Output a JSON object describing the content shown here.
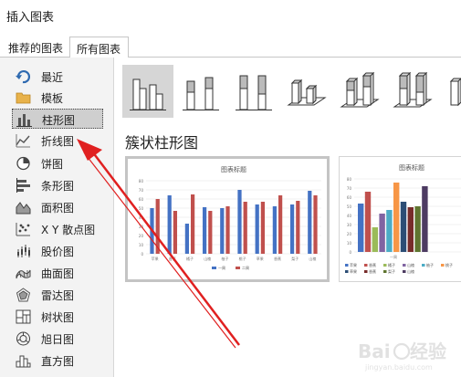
{
  "window": {
    "title": "插入图表"
  },
  "tabs": [
    {
      "label": "推荐的图表"
    },
    {
      "label": "所有图表",
      "selected": true
    }
  ],
  "sidebar": {
    "items": [
      {
        "label": "最近",
        "icon": "recent-icon"
      },
      {
        "label": "模板",
        "icon": "folder-icon"
      },
      {
        "label": "柱形图",
        "icon": "column-chart-icon",
        "selected": true
      },
      {
        "label": "折线图",
        "icon": "line-chart-icon"
      },
      {
        "label": "饼图",
        "icon": "pie-chart-icon"
      },
      {
        "label": "条形图",
        "icon": "bar-chart-icon"
      },
      {
        "label": "面积图",
        "icon": "area-chart-icon"
      },
      {
        "label": "X Y 散点图",
        "icon": "scatter-chart-icon"
      },
      {
        "label": "股价图",
        "icon": "stock-chart-icon"
      },
      {
        "label": "曲面图",
        "icon": "surface-chart-icon"
      },
      {
        "label": "雷达图",
        "icon": "radar-chart-icon"
      },
      {
        "label": "树状图",
        "icon": "treemap-icon"
      },
      {
        "label": "旭日图",
        "icon": "sunburst-icon"
      },
      {
        "label": "直方图",
        "icon": "histogram-icon"
      }
    ]
  },
  "subtypes": [
    {
      "icon": "clustered-column-icon",
      "selected": true
    },
    {
      "icon": "stacked-column-icon"
    },
    {
      "icon": "percent-stacked-column-icon"
    },
    {
      "icon": "3d-clustered-column-icon"
    },
    {
      "icon": "3d-stacked-column-icon"
    },
    {
      "icon": "3d-percent-stacked-column-icon"
    },
    {
      "icon": "3d-column-icon"
    }
  ],
  "main": {
    "subtype_title": "簇状柱形图"
  },
  "colors": {
    "series1": "#4472c4",
    "series2": "#c0504d",
    "arrow": "#e02020",
    "selected_bg": "#d6d6d6"
  },
  "chart_data": [
    {
      "type": "bar",
      "title": "图表标题",
      "categories": [
        "苹果",
        "香蕉",
        "橘子",
        "山楂",
        "柚子",
        "桃子",
        "草果",
        "香蕉",
        "梨子",
        "山楂"
      ],
      "series": [
        {
          "name": "一周",
          "values": [
            50,
            64,
            33,
            51,
            50,
            70,
            54,
            52,
            54,
            69
          ]
        },
        {
          "name": "二周",
          "values": [
            60,
            47,
            65,
            47,
            52,
            57,
            57,
            64,
            58,
            64
          ]
        }
      ],
      "ylim": [
        0,
        80
      ],
      "yticks": [
        0,
        10,
        20,
        30,
        40,
        50,
        60,
        70,
        80
      ],
      "legend": "bottom",
      "grid": true
    },
    {
      "type": "bar",
      "title": "图表标题",
      "categories": [
        "一周"
      ],
      "series": [
        {
          "name": "苹果",
          "values": [
            53
          ]
        },
        {
          "name": "香蕉",
          "values": [
            66
          ]
        },
        {
          "name": "橘子",
          "values": [
            27
          ]
        },
        {
          "name": "山楂",
          "values": [
            42
          ]
        },
        {
          "name": "柚子",
          "values": [
            46
          ]
        },
        {
          "name": "桃子",
          "values": [
            76
          ]
        },
        {
          "name": "草果",
          "values": [
            55
          ]
        },
        {
          "name": "香蕉",
          "values": [
            49
          ]
        },
        {
          "name": "梨子",
          "values": [
            50
          ]
        },
        {
          "name": "山楂",
          "values": [
            72
          ]
        }
      ],
      "ylim": [
        0,
        80
      ],
      "yticks": [
        0,
        10,
        20,
        30,
        40,
        50,
        60,
        70,
        80
      ],
      "legend": "bottom",
      "grid": true
    }
  ]
}
